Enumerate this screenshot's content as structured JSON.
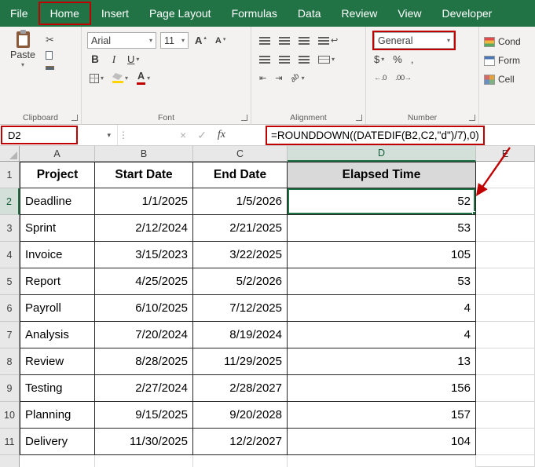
{
  "colors": {
    "excel_green": "#217346",
    "annotation_red": "#c00000",
    "selected_header_fill": "#d3e0d9",
    "d1_cell_fill": "#d9d9d9"
  },
  "tabs": [
    {
      "label": "File"
    },
    {
      "label": "Home"
    },
    {
      "label": "Insert"
    },
    {
      "label": "Page Layout"
    },
    {
      "label": "Formulas"
    },
    {
      "label": "Data"
    },
    {
      "label": "Review"
    },
    {
      "label": "View"
    },
    {
      "label": "Developer"
    }
  ],
  "active_tab": "Home",
  "icons": {
    "dropdown": "▾",
    "cut": "✂",
    "cancel": "×",
    "enter": "✓",
    "handle_dots": "⋮",
    "grow_font_letter": "A",
    "shrink_font_letter": "A",
    "font_color_letter": "A",
    "orientation": "ab",
    "wrap": "↩",
    "indent_decrease": "⇤",
    "indent_increase": "⇥",
    "increase_decimal": "←.0",
    "decrease_decimal": ".00→",
    "up_caret": "▴",
    "down_caret": "▾"
  },
  "ribbon": {
    "clipboard": {
      "group_label": "Clipboard",
      "paste_label": "Paste"
    },
    "font": {
      "group_label": "Font",
      "font_name": "Arial",
      "font_size": "11",
      "bold": "B",
      "italic": "I",
      "underline": "U"
    },
    "alignment": {
      "group_label": "Alignment"
    },
    "number": {
      "group_label": "Number",
      "format": "General",
      "currency": "$",
      "percent": "%",
      "comma": ","
    },
    "styles": {
      "items": [
        {
          "label": "Cond"
        },
        {
          "label": "Form"
        },
        {
          "label": "Cell"
        }
      ]
    }
  },
  "formula_bar": {
    "name_box": "D2",
    "fx_label": "fx",
    "formula": "=ROUNDDOWN((DATEDIF(B2,C2,\"d\")/7),0)"
  },
  "grid": {
    "column_letters": [
      "A",
      "B",
      "C",
      "D",
      "E"
    ],
    "selected_cell": "D2",
    "selected_column": "D",
    "selected_row": "2",
    "columns": [
      "Project",
      "Start Date",
      "End Date",
      "Elapsed Time"
    ],
    "rows": [
      [
        "Deadline",
        "1/1/2025",
        "1/5/2026",
        "52"
      ],
      [
        "Sprint",
        "2/12/2024",
        "2/21/2025",
        "53"
      ],
      [
        "Invoice",
        "3/15/2023",
        "3/22/2025",
        "105"
      ],
      [
        "Report",
        "4/25/2025",
        "5/2/2026",
        "53"
      ],
      [
        "Payroll",
        "6/10/2025",
        "7/12/2025",
        "4"
      ],
      [
        "Analysis",
        "7/20/2024",
        "8/19/2024",
        "4"
      ],
      [
        "Review",
        "8/28/2025",
        "11/29/2025",
        "13"
      ],
      [
        "Testing",
        "2/27/2024",
        "2/28/2027",
        "156"
      ],
      [
        "Planning",
        "9/15/2025",
        "9/20/2028",
        "157"
      ],
      [
        "Delivery",
        "11/30/2025",
        "12/2/2027",
        "104"
      ]
    ]
  }
}
